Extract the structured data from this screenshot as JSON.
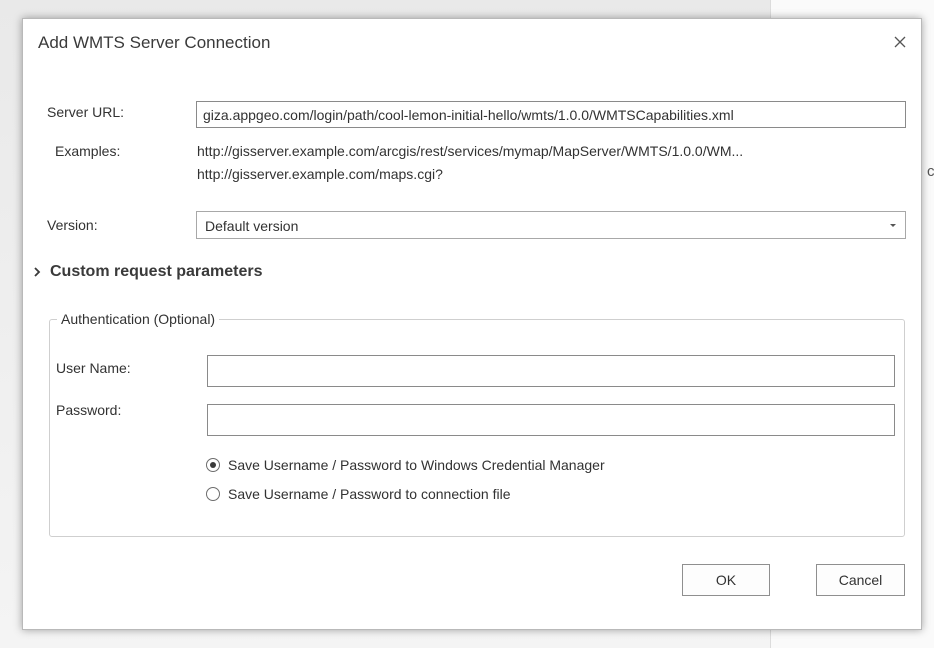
{
  "backdrop": {
    "edge_char": "c"
  },
  "dialog": {
    "title": "Add WMTS Server Connection",
    "close_icon": "close-icon",
    "server_url": {
      "label": "Server URL:",
      "value": "giza.appgeo.com/login/path/cool-lemon-initial-hello/wmts/1.0.0/WMTSCapabilities.xml"
    },
    "examples": {
      "label": "Examples:",
      "lines": [
        "http://gisserver.example.com/arcgis/rest/services/mymap/MapServer/WMTS/1.0.0/WM...",
        "http://gisserver.example.com/maps.cgi?"
      ]
    },
    "version": {
      "label": "Version:",
      "selected": "Default version"
    },
    "custom_params": {
      "label": "Custom request parameters",
      "expanded": false
    },
    "authentication": {
      "legend": "Authentication (Optional)",
      "username_label": "User Name:",
      "username_value": "",
      "password_label": "Password:",
      "password_value": "",
      "options": [
        {
          "label": "Save Username / Password to Windows Credential Manager",
          "checked": true
        },
        {
          "label": "Save Username / Password to connection file",
          "checked": false
        }
      ]
    },
    "buttons": {
      "ok": "OK",
      "cancel": "Cancel"
    }
  }
}
